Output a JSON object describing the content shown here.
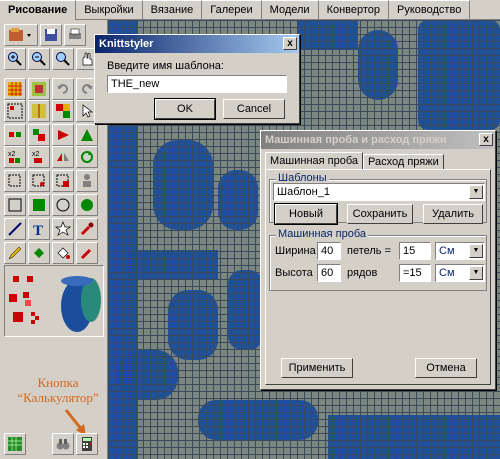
{
  "menu_tabs": [
    "Рисование",
    "Выкройки",
    "Вязание",
    "Галереи",
    "Модели",
    "Конвертор",
    "Руководство"
  ],
  "active_tab": "Рисование",
  "annotation": {
    "line1": "Кнопка",
    "line2": "“Калькулятор”"
  },
  "name_dialog": {
    "title": "Knittstyler",
    "prompt": "Введите имя шаблона:",
    "value": "THE_new",
    "ok": "OK",
    "cancel": "Cancel",
    "close": "x"
  },
  "gauge_dialog": {
    "title": "Машинная проба и расход пряжи",
    "close": "x",
    "tabs": [
      "Машинная проба",
      "Расход пряжи"
    ],
    "templates_group": "Шаблоны",
    "template_selected": "Шаблон_1",
    "btn_new": "Новый",
    "btn_save": "Сохранить",
    "btn_delete": "Удалить",
    "gauge_group": "Машинная проба",
    "width_label": "Ширина",
    "width_value": "40",
    "stitches_label": "петель =",
    "stitches_value": "15",
    "width_unit": "См",
    "height_label": "Высота",
    "height_value": "60",
    "rows_label": "рядов",
    "rows_value": "=15",
    "height_unit": "См",
    "btn_apply": "Применить",
    "btn_cancel": "Отмена"
  },
  "colors": {
    "canvas_gray": "#7a867e",
    "pattern_blue": "#1a4d9c",
    "accent_orange": "#d2691e"
  }
}
